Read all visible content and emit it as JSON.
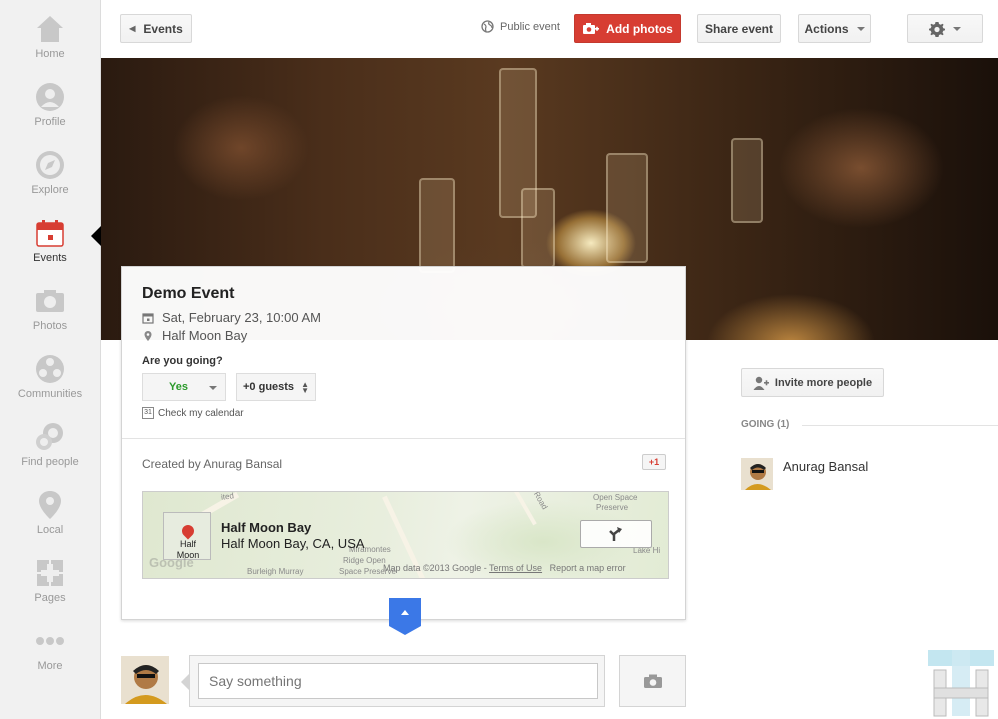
{
  "sidebar": {
    "items": [
      {
        "label": "Home",
        "icon": "home-icon"
      },
      {
        "label": "Profile",
        "icon": "profile-icon"
      },
      {
        "label": "Explore",
        "icon": "compass-icon"
      },
      {
        "label": "Events",
        "icon": "calendar-icon",
        "active": true
      },
      {
        "label": "Photos",
        "icon": "camera-icon"
      },
      {
        "label": "Communities",
        "icon": "communities-icon"
      },
      {
        "label": "Find people",
        "icon": "find-people-icon"
      },
      {
        "label": "Local",
        "icon": "map-pin-icon"
      },
      {
        "label": "Pages",
        "icon": "pages-icon"
      },
      {
        "label": "More",
        "icon": "more-dots-icon"
      }
    ]
  },
  "toolbar": {
    "back_label": "Events",
    "visibility_label": "Public event",
    "add_photos_label": "Add photos",
    "share_label": "Share event",
    "actions_label": "Actions"
  },
  "event": {
    "title": "Demo Event",
    "date": "Sat, February 23, 10:00 AM",
    "location": "Half Moon Bay",
    "going_question": "Are you going?",
    "rsvp_value": "Yes",
    "guests_value": "+0 guests",
    "calendar_link": "Check my calendar",
    "calendar_icon_text": "31",
    "created_by": "Created by Anurag Bansal",
    "plus_one": "+1"
  },
  "map": {
    "place_name": "Half Moon Bay",
    "place_address": "Half Moon Bay, CA, USA",
    "thumb_label_1": "Half",
    "thumb_label_2": "Moon Bay",
    "data_credit": "Map data ©2013 Google",
    "terms": "Terms of Use",
    "report": "Report a map error",
    "logo": "Google",
    "labels": [
      "Open Space",
      "Preserve",
      "Miramontes",
      "Ridge Open",
      "Space Preserve",
      "Burleigh Murray",
      "Space Pres",
      "Lake Hi",
      "ited",
      "Rd",
      "Road"
    ]
  },
  "guests": {
    "invite_label": "Invite more people",
    "going_header": "GOING (1)",
    "attendees": [
      {
        "name": "Anurag Bansal"
      }
    ]
  },
  "post": {
    "placeholder": "Say something"
  },
  "colors": {
    "accent_red": "#d73d32",
    "going_green": "#2b9a2b",
    "collapse_blue": "#3b78e7"
  }
}
